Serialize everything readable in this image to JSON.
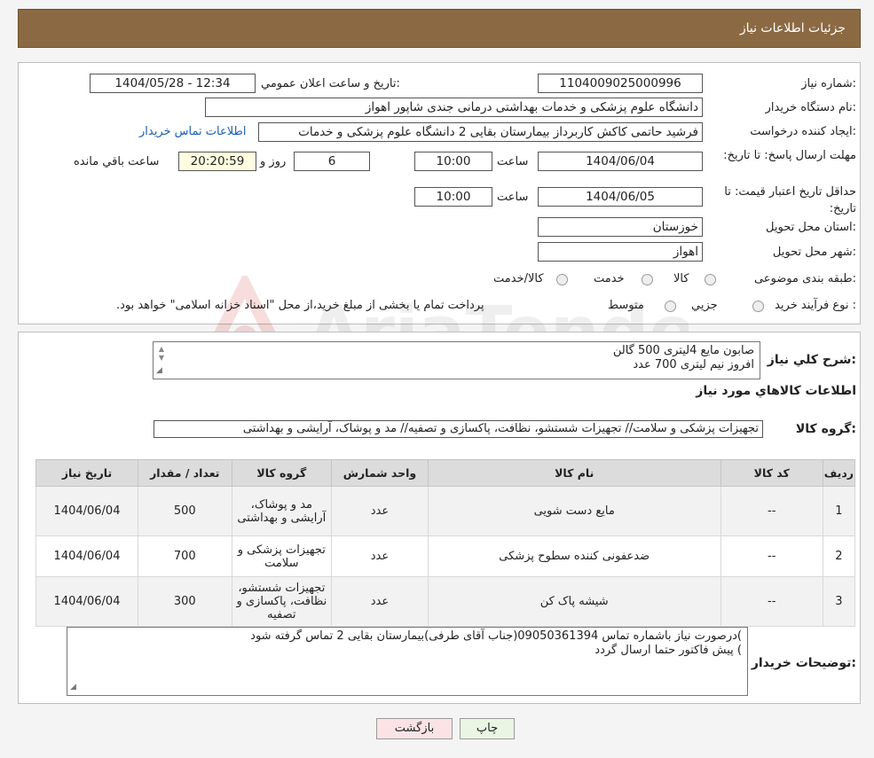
{
  "header": {
    "title": "جزئیات اطلاعات نیاز"
  },
  "form": {
    "need_number_label": "شماره نیاز:",
    "need_number": "1104009025000996",
    "announce_label": "تاریخ و ساعت اعلان عمومي:",
    "announce_value": "1404/05/28 - 12:34",
    "buyer_org_label": "نام دستگاه خریدار:",
    "buyer_org": "دانشگاه علوم پزشکی و خدمات بهداشتی درمانی جندی شاپور اهواز",
    "creator_label": "ایجاد کننده درخواست:",
    "creator": "فرشید حاتمی کاکش کاربرداز بیمارستان بقایی 2 دانشگاه علوم پزشکی و خدمات",
    "contact_link": "اطلاعات تماس خریدار",
    "deadline_label": "مهلت ارسال پاسخ: تا تاریخ:",
    "deadline_date": "1404/06/04",
    "time_label": "ساعت",
    "deadline_time": "10:00",
    "days_value": "6",
    "days_label": "روز و",
    "remaining_time": "20:20:59",
    "remaining_label": "ساعت باقي مانده",
    "validity_label": "حداقل تاریخ اعتبار قیمت: تا تاریخ:",
    "validity_date": "1404/06/05",
    "validity_time": "10:00",
    "province_label": "استان محل تحویل:",
    "province": "خوزستان",
    "city_label": "شهر محل تحویل:",
    "city": "اهواز",
    "category_label": "طبقه بندی موضوعی:",
    "category_options": [
      "کالا",
      "خدمت",
      "کالا/خدمت"
    ],
    "process_label": "نوع فرآیند خرید :",
    "process_options": [
      "جزیي",
      "متوسط"
    ],
    "process_note": "پرداخت تمام یا بخشی از مبلغ خرید،از محل \"اسناد خزانه اسلامی\" خواهد بود."
  },
  "description": {
    "label": "شرح کلي نیاز:",
    "lines": [
      "صابون مایع 4لیتری 500 گالن",
      "افروز نیم لیتری 700 عدد"
    ]
  },
  "goods": {
    "section_title": "اطلاعات کالاهاي مورد نیاز",
    "group_label": "گروه کالا:",
    "group_value": "تجهیزات پزشکی و سلامت// تجهیزات شستشو، نظافت، پاکسازی و تصفیه// مد و پوشاک، آرایشی و بهداشتی"
  },
  "table": {
    "headers": [
      "ردیف",
      "کد کالا",
      "نام کالا",
      "واحد شمارش",
      "گروه کالا",
      "تعداد / مقدار",
      "تاریخ نیاز"
    ],
    "rows": [
      [
        "1",
        "--",
        "مایع دست شویی",
        "عدد",
        "مد و پوشاک، آرایشی و بهداشتی",
        "500",
        "1404/06/04"
      ],
      [
        "2",
        "--",
        "ضدعفونی کننده سطوح پزشکی",
        "عدد",
        "تجهیزات پزشکی و سلامت",
        "700",
        "1404/06/04"
      ],
      [
        "3",
        "--",
        "شیشه پاک کن",
        "عدد",
        "تجهیزات شستشو، نظافت، پاکسازی و تصفیه",
        "300",
        "1404/06/04"
      ]
    ]
  },
  "notes": {
    "label": "توضیحات خریدار:",
    "lines": [
      ")درصورت نیاز باشماره تماس 09050361394(جناب آقای طرفی)بیمارستان بقایی 2 تماس گرفته شود",
      ") پیش فاکتور حتما ارسال گردد"
    ]
  },
  "buttons": {
    "print": "چاپ",
    "back": "بازگشت"
  },
  "watermark": {
    "text": "AriaTender.neT"
  }
}
